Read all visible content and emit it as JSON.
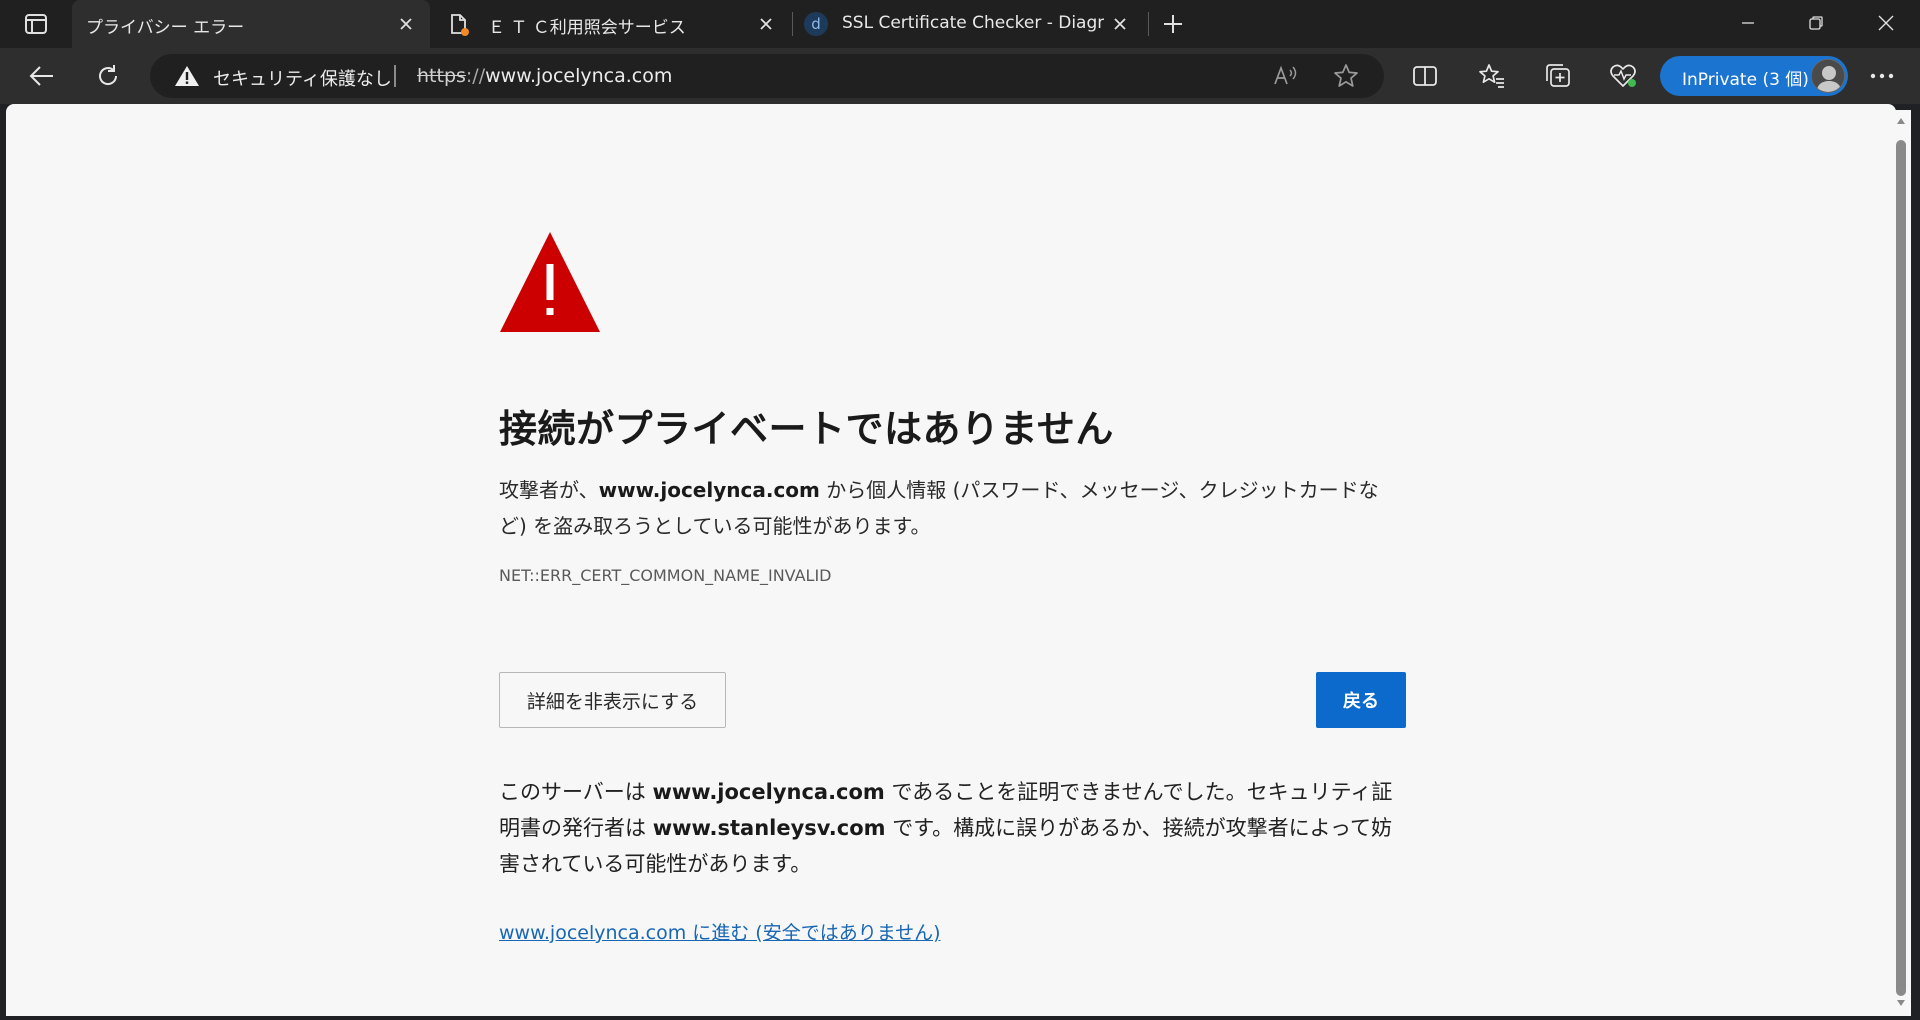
{
  "tabs": [
    {
      "title": "プライバシー エラー",
      "active": true,
      "icon": "window-icon"
    },
    {
      "title": "Ｅ Ｔ Ｃ利用照会サービス",
      "active": false,
      "icon": "document-icon"
    },
    {
      "title": "SSL Certificate Checker - Diagnos",
      "active": false,
      "icon": "site-d-icon",
      "favicon_letter": "d"
    }
  ],
  "omnibox": {
    "security_label": "セキュリティ保護なし",
    "url_scheme": "https",
    "url_sep": "://",
    "url_host": "www.jocelynca.com"
  },
  "inprivate": {
    "label": "InPrivate (3 個)"
  },
  "page": {
    "title": "接続がプライベートではありません",
    "desc_before": "攻撃者が、",
    "desc_domain": "www.jocelynca.com",
    "desc_after": " から個人情報 (パスワード、メッセージ、クレジットカードなど) を盗み取ろうとしている可能性があります。",
    "error_code": "NET::ERR_CERT_COMMON_NAME_INVALID",
    "hide_details_button": "詳細を非表示にする",
    "back_button": "戻る",
    "detail_p1": "このサーバーは ",
    "detail_domain": "www.jocelynca.com",
    "detail_p2": " であることを証明できませんでした。セキュリティ証明書の発行者は ",
    "detail_issuer": "www.stanleysv.com",
    "detail_p3": " です。構成に誤りがあるか、接続が攻撃者によって妨害されている可能性があります。",
    "proceed_link": "www.jocelynca.com に進む (安全ではありません)"
  },
  "colors": {
    "warning_red": "#cc0000",
    "primary_button": "#0b6acb",
    "link": "#1866b4",
    "inprivate": "#1b74d0"
  }
}
